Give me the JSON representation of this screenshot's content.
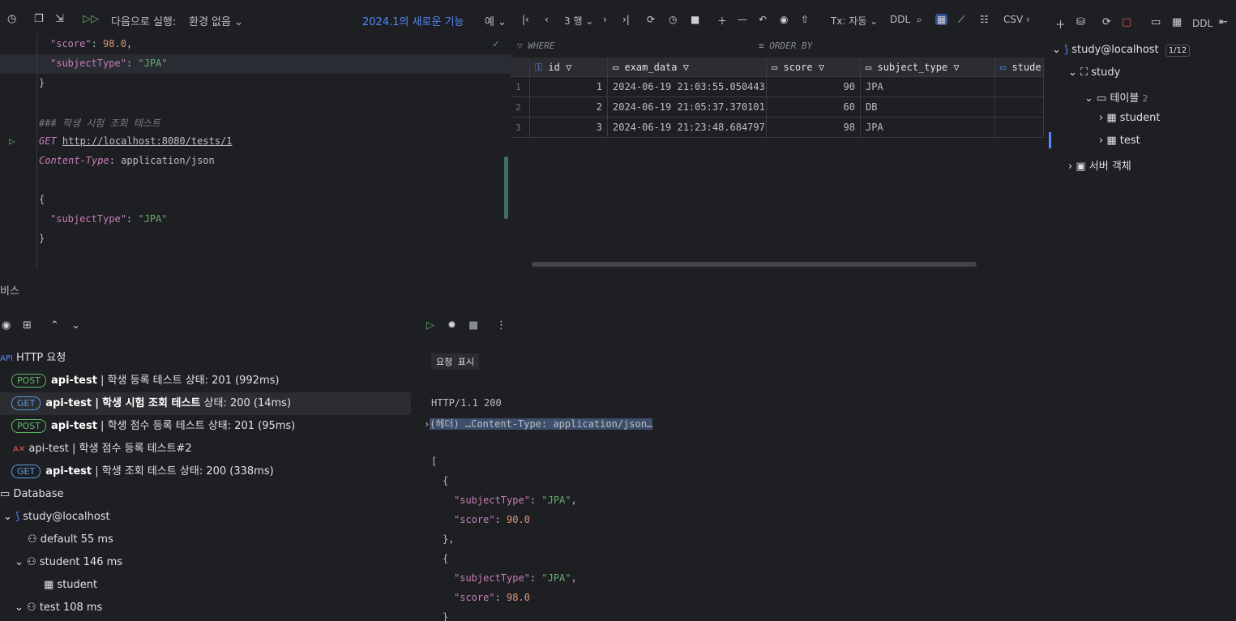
{
  "editor_toolbar": {
    "run_label": "다음으로 실행:",
    "env_label": "환경 없음",
    "whats_new": "2024.1의 새로운 기능",
    "yes_label": "예"
  },
  "editor": {
    "l1_key": "\"score\"",
    "l1_val": "98.0",
    "l2_key": "\"subjectType\"",
    "l2_val": "\"JPA\"",
    "brace_close": "}",
    "comment": "### 학생 시험 조회 테스트",
    "method": "GET",
    "url": "http://localhost:8080/tests/1",
    "header_name": "Content-Type",
    "header_val": "application/json",
    "brace_open": "{",
    "body_key": "\"subjectType\"",
    "body_val": "\"JPA\"",
    "brace_close2": "}"
  },
  "grid_toolbar": {
    "rows": "3 행",
    "tx": "Tx: 자동",
    "ddl": "DDL",
    "csv": "CSV"
  },
  "filter": {
    "where": "WHERE",
    "order_by": "ORDER BY"
  },
  "grid": {
    "headers": [
      "id",
      "exam_data",
      "score",
      "subject_type",
      "stude"
    ],
    "rows": [
      {
        "rn": "1",
        "id": "1",
        "exam_data": "2024-06-19 21:03:55.050443",
        "score": "90",
        "subject_type": "JPA"
      },
      {
        "rn": "2",
        "id": "2",
        "exam_data": "2024-06-19 21:05:37.370101",
        "score": "60",
        "subject_type": "DB"
      },
      {
        "rn": "3",
        "id": "3",
        "exam_data": "2024-06-19 21:23:48.684797",
        "score": "98",
        "subject_type": "JPA"
      }
    ]
  },
  "db_panel": {
    "ddl": "DDL",
    "connection": "study@localhost",
    "counter": "1/12",
    "schema": "study",
    "tables": "테이블",
    "tables_count": "2",
    "table1": "student",
    "table2": "test",
    "server_objects": "서버 객체"
  },
  "services": {
    "title": "비스",
    "http_root": "HTTP 요청",
    "requests": [
      {
        "method": "POST",
        "app": "api-test",
        "name": "학생 등록 테스트 상태: 201 (992ms)"
      },
      {
        "method": "GET",
        "app": "api-test",
        "name_bold": "학생 시험 조회 테스트",
        "name": "상태: 200 (14ms)"
      },
      {
        "method": "POST",
        "app": "api-test",
        "name": "학생 점수 등록 테스트 상태: 201 (95ms)"
      },
      {
        "method": "",
        "app": "",
        "name": "api-test | 학생 점수 등록 테스트#2"
      },
      {
        "method": "GET",
        "app": "api-test",
        "name": "학생 조회 테스트 상태: 200 (338ms)"
      }
    ],
    "database": "Database",
    "db_conn": "study@localhost",
    "sessions": [
      {
        "name": "default",
        "time": "55 ms"
      },
      {
        "name": "student",
        "time": "146 ms"
      },
      {
        "name": "test",
        "time": "108 ms"
      }
    ],
    "student_table": "student"
  },
  "response": {
    "show_request": "요청 표시",
    "status": "HTTP/1.1 200",
    "headers": "(헤더) …Content-Type: application/json…",
    "items": [
      {
        "key1": "\"subjectType\"",
        "val1": "\"JPA\"",
        "key2": "\"score\"",
        "val2": "90.0"
      },
      {
        "key1": "\"subjectType\"",
        "val1": "\"JPA\"",
        "key2": "\"score\"",
        "val2": "98.0"
      }
    ],
    "bracket_open": "[",
    "obj_open": "{",
    "obj_close": "},",
    "obj_close_last": "}"
  }
}
